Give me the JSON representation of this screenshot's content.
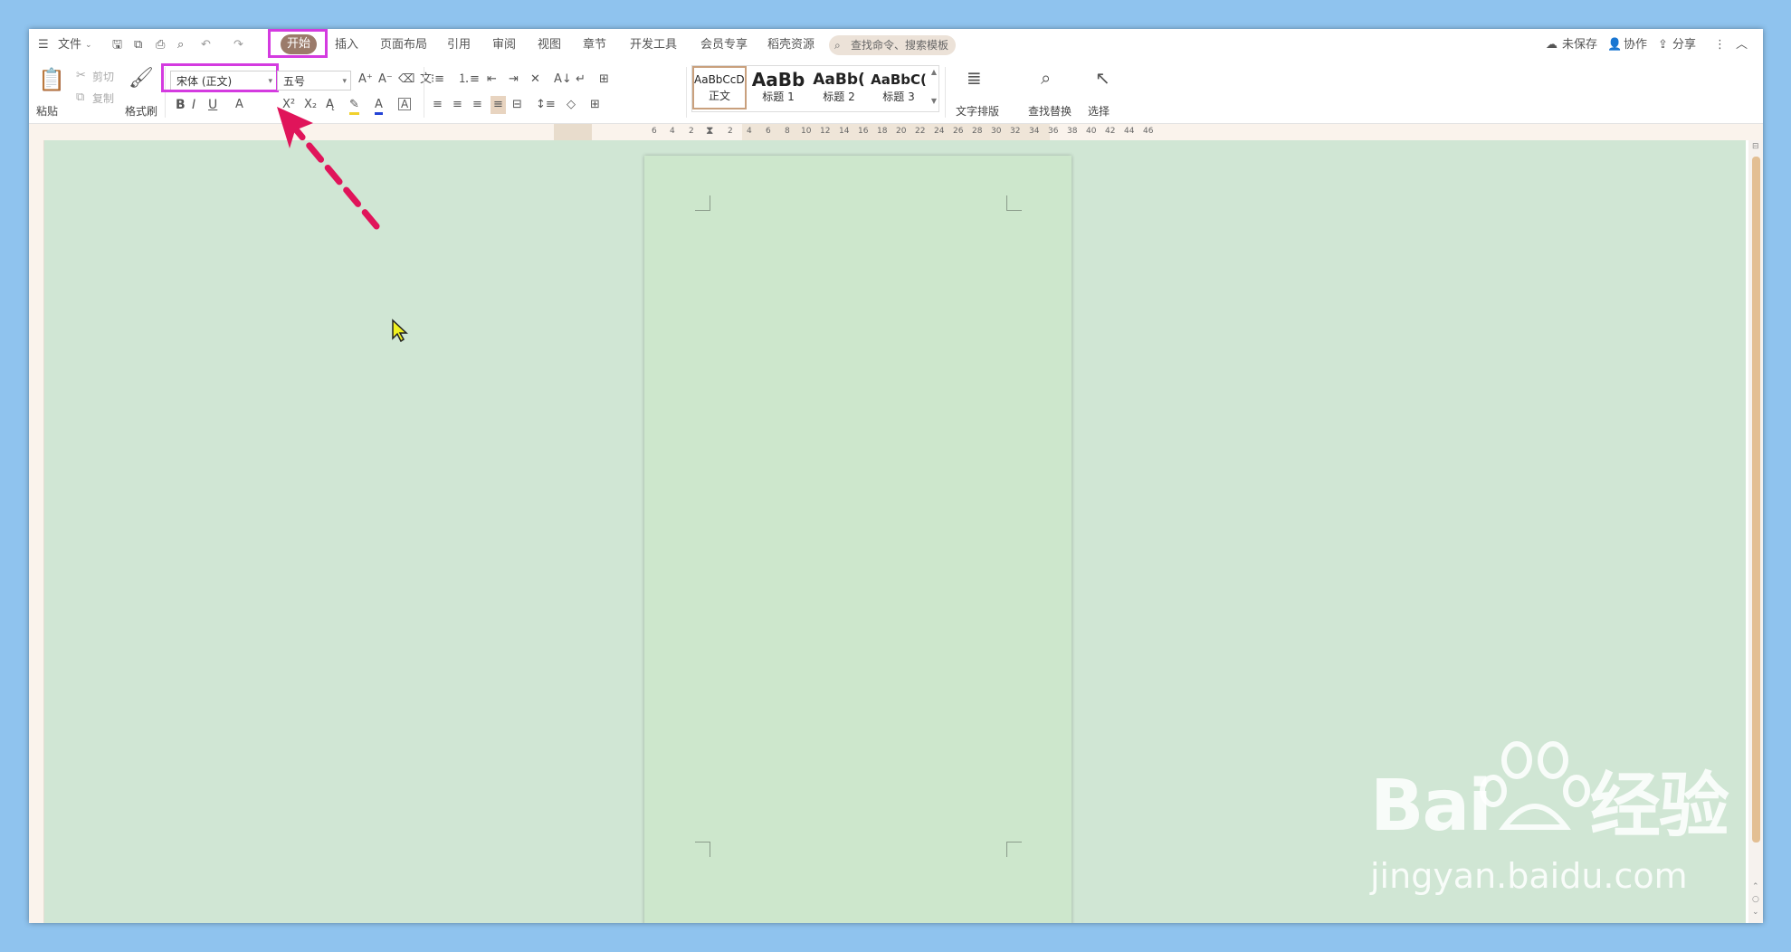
{
  "menu": {
    "file_label": "文件",
    "tabs": [
      "开始",
      "插入",
      "页面布局",
      "引用",
      "审阅",
      "视图",
      "章节",
      "开发工具",
      "会员专享",
      "稻壳资源"
    ],
    "search_placeholder": "查找命令、搜索模板",
    "right": {
      "save_status": "未保存",
      "collab": "协作",
      "share": "分享"
    }
  },
  "ribbon": {
    "paste": "粘贴",
    "cut": "剪切",
    "copy": "复制",
    "format_painter": "格式刷",
    "font_name": "宋体 (正文)",
    "font_size": "五号",
    "styles": [
      {
        "preview": "AaBbCcDd",
        "name": "正文"
      },
      {
        "preview": "AaBb",
        "name": "标题 1"
      },
      {
        "preview": "AaBb(",
        "name": "标题 2"
      },
      {
        "preview": "AaBbC(",
        "name": "标题 3"
      }
    ],
    "text_layout": "文字排版",
    "find_replace": "查找替换",
    "select": "选择"
  },
  "ruler_labels": [
    "6",
    "4",
    "2",
    "2",
    "4",
    "6",
    "8",
    "10",
    "12",
    "14",
    "16",
    "18",
    "20",
    "22",
    "24",
    "26",
    "28",
    "30",
    "32",
    "34",
    "36",
    "38",
    "40",
    "42",
    "44",
    "46"
  ],
  "annotation_color": "#d43be0",
  "arrow_color": "#e0145a",
  "watermark": {
    "line1": "Bai",
    "line1b": "经验",
    "line2": "jingyan.baidu.com"
  }
}
